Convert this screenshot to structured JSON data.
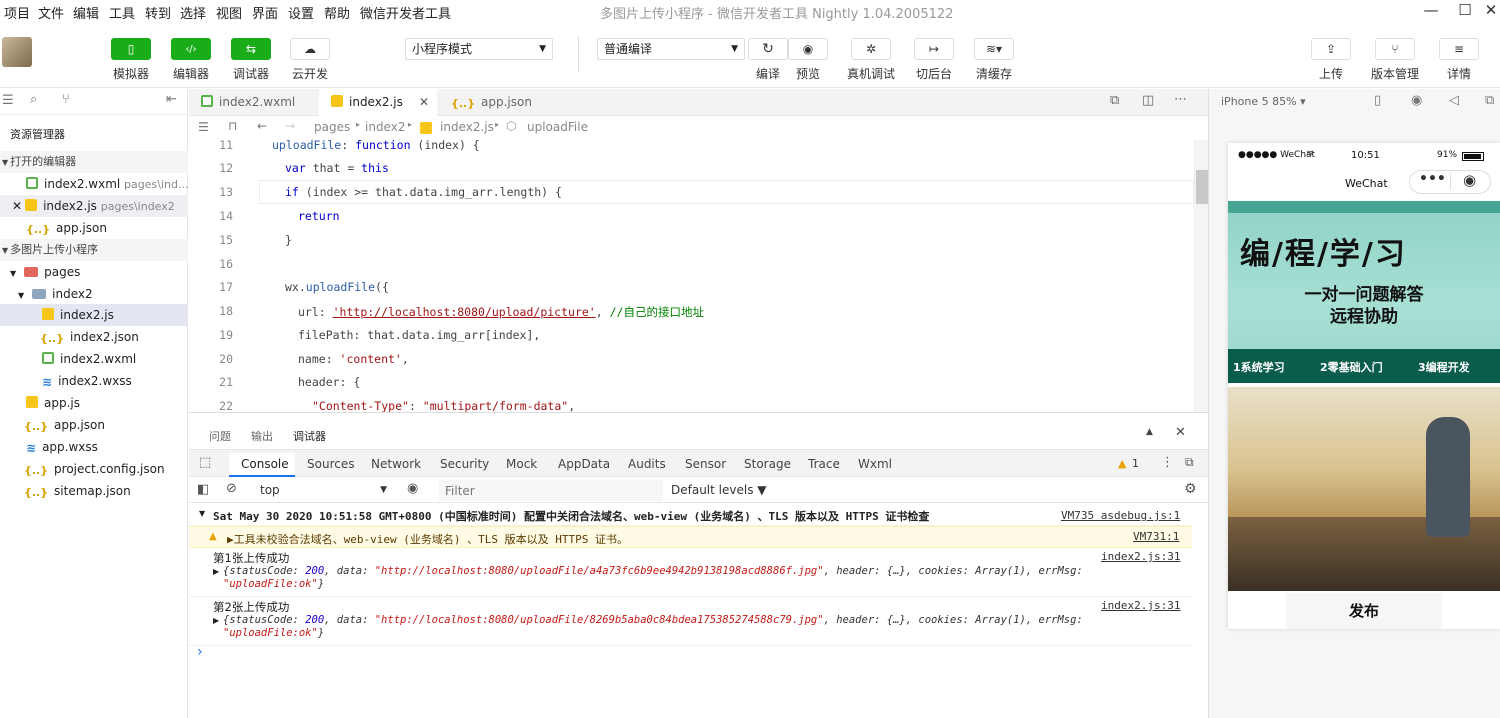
{
  "menubar": {
    "items": [
      "项目",
      "文件",
      "编辑",
      "工具",
      "转到",
      "选择",
      "视图",
      "界面",
      "设置",
      "帮助",
      "微信开发者工具"
    ],
    "window_title": "多图片上传小程序 - 微信开发者工具 Nightly 1.04.2005122"
  },
  "toolbar": {
    "simulator": "模拟器",
    "editor": "编辑器",
    "debugger": "调试器",
    "cloud": "云开发",
    "mode_select": "小程序模式",
    "compile_select": "普通编译",
    "compile": "编译",
    "preview": "预览",
    "remote_debug": "真机调试",
    "background": "切后台",
    "clear_cache": "清缓存",
    "upload": "上传",
    "version": "版本管理",
    "details": "详情"
  },
  "sidebar": {
    "title": "资源管理器",
    "open_editors": "打开的编辑器",
    "open_files": [
      {
        "name": "index2.wxml",
        "path": "pages\\ind..."
      },
      {
        "name": "index2.js",
        "path": "pages\\index2"
      },
      {
        "name": "app.json",
        "path": ""
      }
    ],
    "project": "多图片上传小程序",
    "tree": [
      "pages",
      "index2",
      "index2.js",
      "index2.json",
      "index2.wxml",
      "index2.wxss",
      "app.js",
      "app.json",
      "app.wxss",
      "project.config.json",
      "sitemap.json"
    ]
  },
  "editor": {
    "tabs": [
      "index2.wxml",
      "index2.js",
      "app.json"
    ],
    "breadcrumb": [
      "pages",
      "index2",
      "index2.js",
      "uploadFile"
    ],
    "line_numbers": [
      "11",
      "12",
      "13",
      "14",
      "15",
      "16",
      "17",
      "18",
      "19",
      "20",
      "21",
      "22"
    ],
    "code": {
      "l11a": "uploadFile",
      "l11b": ": ",
      "l11c": "function",
      "l11d": " (index) {",
      "l12a": "var",
      "l12b": " that = ",
      "l12c": "this",
      "l13a": "if",
      "l13b": " (index >= that.data.img_arr.length) {",
      "l14": "return",
      "l15": "}",
      "l17a": "wx.",
      "l17b": "uploadFile",
      "l17c": "({",
      "l18a": "url: ",
      "l18b": "'http://localhost:8080/upload/picture'",
      "l18c": ", ",
      "l18d": "//自己的接口地址",
      "l19": "filePath: that.data.img_arr[index],",
      "l20a": "name: ",
      "l20b": "'content'",
      "l20c": ",",
      "l21": "header: {",
      "l22a": "\"Content-Type\"",
      "l22b": ": ",
      "l22c": "\"multipart/form-data\"",
      "l22d": ","
    }
  },
  "console": {
    "panel_tabs": [
      "问题",
      "输出",
      "调试器"
    ],
    "devtools_tabs": [
      "Console",
      "Sources",
      "Network",
      "Security",
      "Mock",
      "AppData",
      "Audits",
      "Sensor",
      "Storage",
      "Trace",
      "Wxml"
    ],
    "warning_count": "1",
    "context": "top",
    "filter_placeholder": "Filter",
    "levels": "Default levels ▼",
    "group_header": "Sat May 30 2020 10:51:58 GMT+0800 (中国标准时间) 配置中关闭合法域名、web-view (业务域名) 、TLS 版本以及 HTTPS 证书检查",
    "group_src": "VM735 asdebug.js:1",
    "warning_text": "▶工具未校验合法域名、web-view (业务域名) 、TLS 版本以及 HTTPS 证书。",
    "warning_src": "VM731:1",
    "log1_title": "第1张上传成功",
    "log1_src": "index2.js:31",
    "log1_url": "\"http://localhost:8080/uploadFile/a4a73fc6b9ee4942b9138198acd8886f.jpg\"",
    "log2_title": "第2张上传成功",
    "log2_src": "index2.js:31",
    "log2_url": "\"http://localhost:8080/uploadFile/8269b5aba0c84bdea175385274588c79.jpg\"",
    "obj_status": "200",
    "obj_tail": ", header: {…}, cookies: Array(1), errMsg:",
    "obj_errmsg": "\"uploadFile:ok\"",
    "prompt": "›"
  },
  "simulator": {
    "device": "iPhone 5 85% ▾",
    "carrier": "●●●●● WeChat",
    "time": "10:51",
    "battery": "91%",
    "nav_title": "WeChat",
    "banner_title": "编/程/学/习",
    "banner_sub1": "一对一问题解答",
    "banner_sub2": "远程协助",
    "banner_tags": [
      "1系统学习",
      "2零基础入门",
      "3编程开发"
    ],
    "publish": "发布"
  }
}
